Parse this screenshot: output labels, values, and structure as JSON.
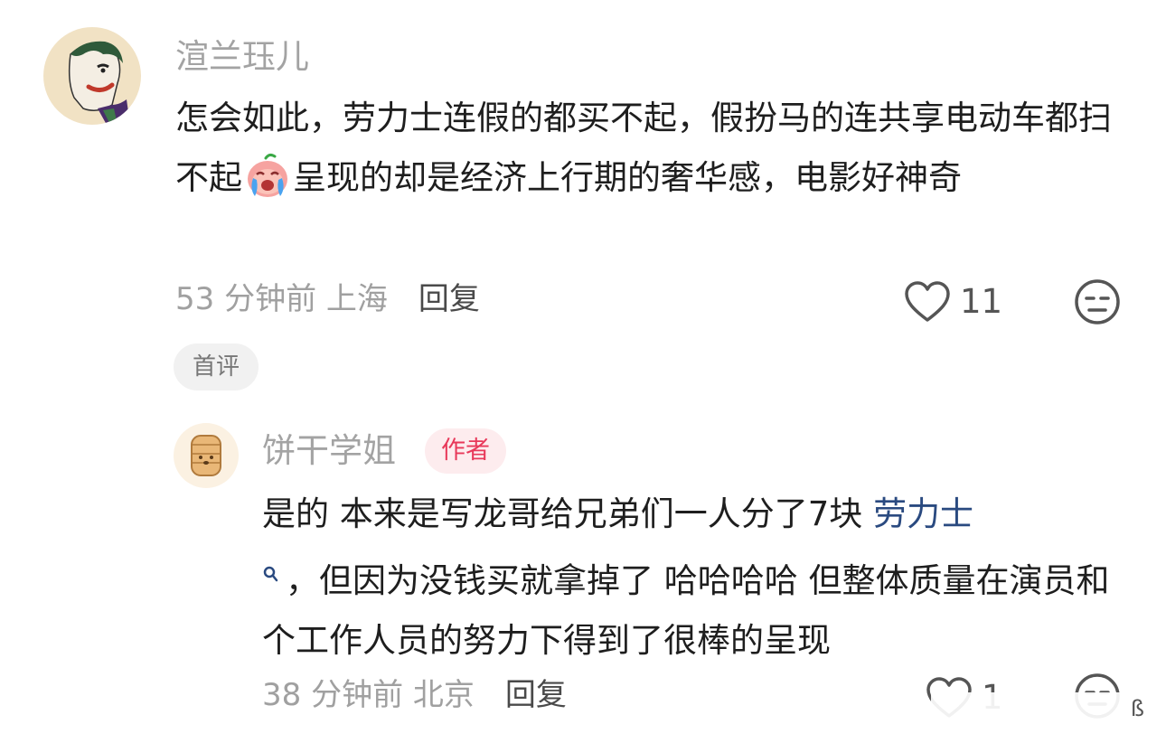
{
  "comments": [
    {
      "username": "渲兰珏儿",
      "text_before_emoji": "怎会如此，劳力士连假的都买不起，假扮马的连共享电动车都扫不起",
      "emoji": "crying-face-emoji",
      "text_after_emoji": "呈现的却是经济上行期的奢华感，电影好神奇",
      "time": "53 分钟前",
      "location": "上海",
      "reply_label": "回复",
      "like_count": "11",
      "badge": "首评",
      "reply": {
        "username": "饼干学姐",
        "author_tag": "作者",
        "text_part1": "是的 本来是写龙哥给兄弟们一人分了7块 ",
        "topic_link": "劳力士",
        "text_part2": "，但因为没钱买就拿掉了 哈哈哈哈 但整体质量在演员和个工作人员的努力下得到了很棒的呈现",
        "time": "38 分钟前",
        "location": "北京",
        "reply_label": "回复",
        "like_count": "1"
      }
    }
  ],
  "watermark_glyph": "ß",
  "colors": {
    "username": "#a3a3a3",
    "body_text": "#1e1e1e",
    "meta_text": "#a0a0a0",
    "author_tag_text": "#e8395a",
    "author_tag_bg": "#fdecee",
    "topic_link": "#2a4a80"
  }
}
